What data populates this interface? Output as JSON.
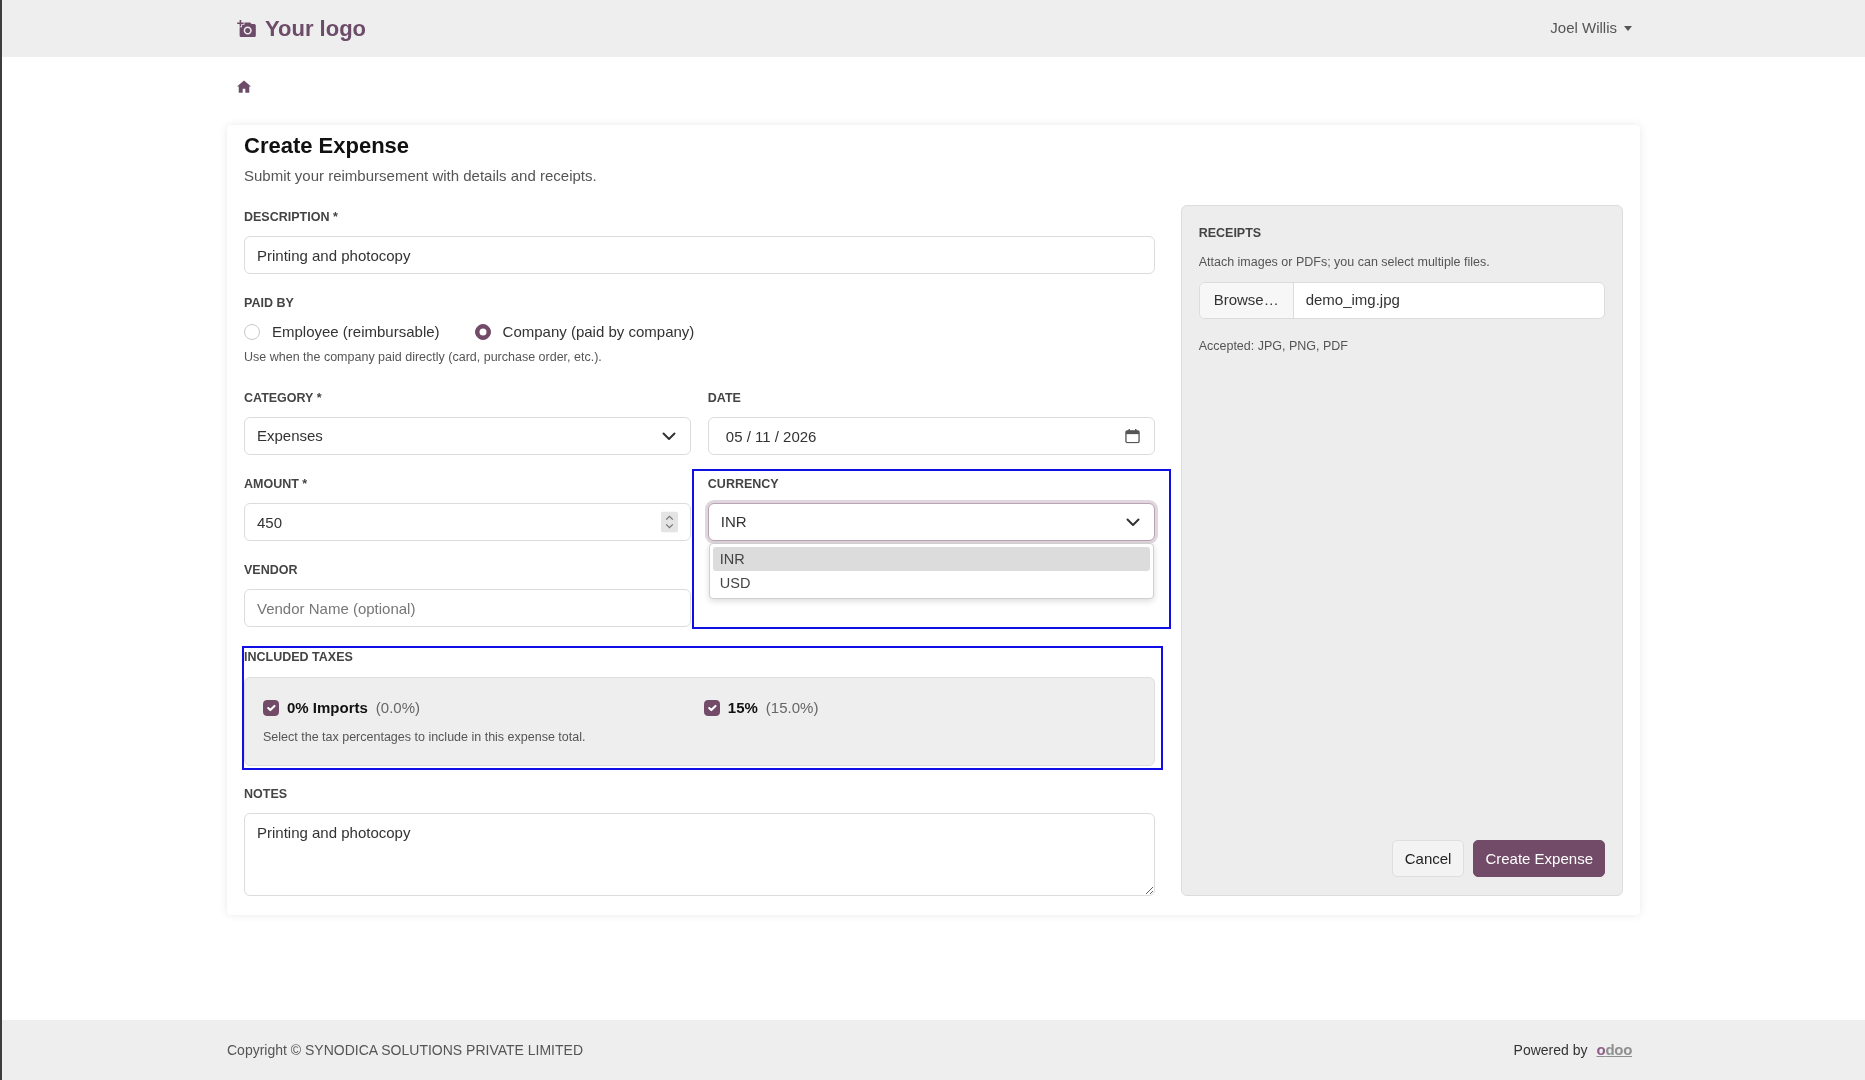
{
  "header": {
    "logo_text": "Your logo",
    "user_name": "Joel Willis"
  },
  "form": {
    "title": "Create Expense",
    "subtitle": "Submit your reimbursement with details and receipts.",
    "description": {
      "label": "DESCRIPTION *",
      "value": "Printing and photocopy"
    },
    "paid_by": {
      "label": "PAID BY",
      "options": [
        {
          "label": "Employee (reimbursable)",
          "selected": false
        },
        {
          "label": "Company (paid by company)",
          "selected": true
        }
      ],
      "help": "Use when the company paid directly (card, purchase order, etc.)."
    },
    "category": {
      "label": "CATEGORY *",
      "value": "Expenses"
    },
    "date": {
      "label": "DATE",
      "value": "05 / 11 / 2026"
    },
    "amount": {
      "label": "AMOUNT *",
      "value": "450"
    },
    "currency": {
      "label": "CURRENCY",
      "value": "INR",
      "highlighted": true,
      "expanded": true,
      "options": [
        {
          "label": "INR",
          "selected": true
        },
        {
          "label": "USD",
          "selected": false
        }
      ]
    },
    "vendor": {
      "label": "VENDOR",
      "placeholder": "Vendor Name (optional)"
    },
    "included_taxes": {
      "label": "INCLUDED TAXES",
      "highlighted": true,
      "items": [
        {
          "name": "0% Imports",
          "rate": "(0.0%)",
          "checked": true
        },
        {
          "name": "15%",
          "rate": "(15.0%)",
          "checked": true
        }
      ],
      "help": "Select the tax percentages to include in this expense total."
    },
    "notes": {
      "label": "NOTES",
      "value": "Printing and photocopy"
    }
  },
  "receipts": {
    "label": "RECEIPTS",
    "help": "Attach images or PDFs; you can select multiple files.",
    "browse_button": "Browse…",
    "file_name": "demo_img.jpg",
    "accepted": "Accepted: JPG, PNG, PDF"
  },
  "actions": [
    {
      "label": "Cancel",
      "kind": "secondary"
    },
    {
      "label": "Create Expense",
      "kind": "primary"
    }
  ],
  "footer": {
    "copyright": "Copyright © SYNODICA SOLUTIONS PRIVATE LIMITED",
    "powered_by": "Powered by",
    "logo_text": "odoo"
  }
}
